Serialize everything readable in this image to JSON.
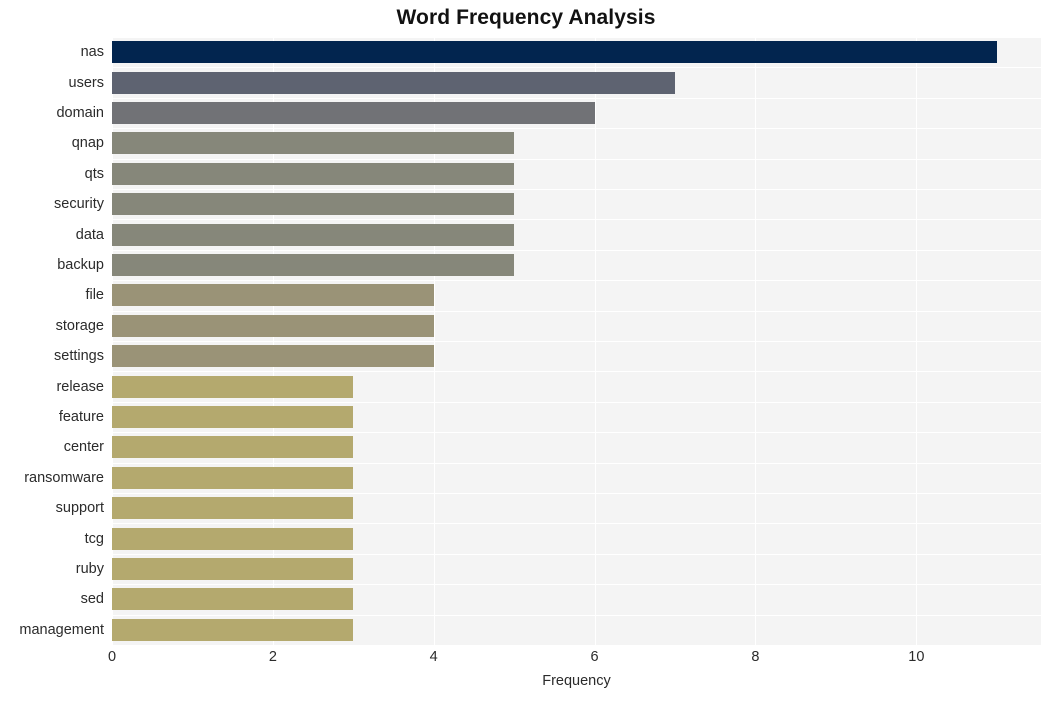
{
  "chart_data": {
    "type": "bar",
    "orientation": "horizontal",
    "title": "Word Frequency Analysis",
    "xlabel": "Frequency",
    "ylabel": "",
    "categories": [
      "nas",
      "users",
      "domain",
      "qnap",
      "qts",
      "security",
      "data",
      "backup",
      "file",
      "storage",
      "settings",
      "release",
      "feature",
      "center",
      "ransomware",
      "support",
      "tcg",
      "ruby",
      "sed",
      "management"
    ],
    "values": [
      11,
      7,
      6,
      5,
      5,
      5,
      5,
      5,
      4,
      4,
      4,
      3,
      3,
      3,
      3,
      3,
      3,
      3,
      3,
      3
    ],
    "bar_colors": [
      "#02254f",
      "#5e6371",
      "#717276",
      "#86877a",
      "#86877a",
      "#86877a",
      "#86877a",
      "#86877a",
      "#9a9377",
      "#9a9377",
      "#9a9377",
      "#b4a96e",
      "#b4a96e",
      "#b4a96e",
      "#b4a96e",
      "#b4a96e",
      "#b4a96e",
      "#b4a96e",
      "#b4a96e",
      "#b4a96e"
    ],
    "xlim": [
      0,
      11.55
    ],
    "xticks": [
      0,
      2,
      4,
      6,
      8,
      10
    ],
    "xtick_labels": [
      "0",
      "2",
      "4",
      "6",
      "8",
      "10"
    ],
    "grid": true,
    "grid_color": "#ffffff",
    "plot_background": "#f4f4f4",
    "figure_background": "#ffffff",
    "legend": null
  }
}
